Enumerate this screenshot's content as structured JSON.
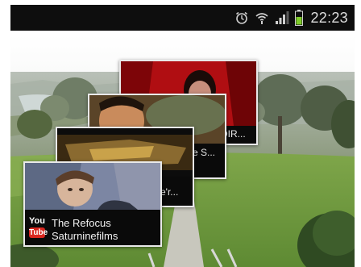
{
  "status_bar": {
    "time": "22:23",
    "icons": [
      "alarm-icon",
      "wifi-icon",
      "signal-icon",
      "battery-icon"
    ]
  },
  "youtube_widget": {
    "logo": {
      "top": "You",
      "bottom": "Tube"
    },
    "cards": [
      {
        "title": "The Refocus",
        "channel": "Saturninefilms"
      },
      {
        "peek_text": "e'r..."
      },
      {
        "peek_text": "e S..."
      },
      {
        "peek_text": "DIR..."
      }
    ]
  },
  "colors": {
    "status_bar_bg": "#0e0e0e",
    "youtube_red": "#d8261f",
    "card_border": "#e9e9e9",
    "grass": "#6d9a3e"
  }
}
